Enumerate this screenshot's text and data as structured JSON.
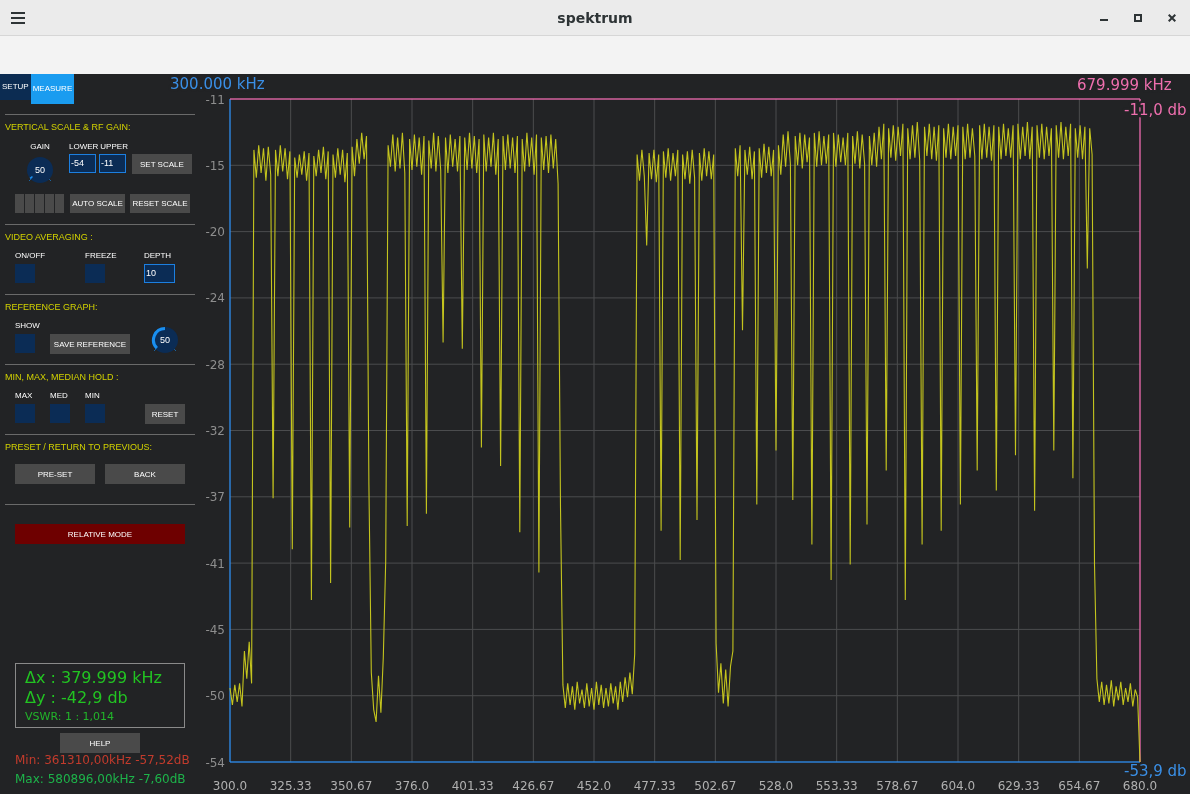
{
  "window": {
    "title": "spektrum"
  },
  "tabs": [
    {
      "label": "SETUP",
      "selected": false
    },
    {
      "label": "MEASURE",
      "selected": true
    }
  ],
  "vertical_scale": {
    "heading": "VERTICAL SCALE & RF GAIN:",
    "gain": {
      "label": "GAIN",
      "value": "50",
      "level": 0.03
    },
    "lower": {
      "label": "LOWER",
      "value": "-54"
    },
    "upper": {
      "label": "UPPER",
      "value": "-11"
    },
    "set_button": "SET SCALE",
    "step_buttons": [
      {
        "selected": false
      },
      {
        "selected": false
      },
      {
        "selected": false
      },
      {
        "selected": false
      },
      {
        "selected": false
      }
    ],
    "auto_button": "AUTO SCALE",
    "reset_button": "RESET SCALE"
  },
  "video_averaging": {
    "heading": "VIDEO AVERAGING :",
    "toggles": [
      {
        "label": "ON/OFF",
        "on": false
      },
      {
        "label": "FREEZE",
        "on": false
      }
    ],
    "depth": {
      "label": "DEPTH",
      "value": "10"
    }
  },
  "reference_graph": {
    "heading": "REFERENCE GRAPH:",
    "show": {
      "label": "SHOW",
      "on": false
    },
    "save_button": "SAVE REFERENCE",
    "knob": {
      "value": "50",
      "level": 0.5
    }
  },
  "hold": {
    "heading": "MIN, MAX, MEDIAN HOLD :",
    "toggles": [
      {
        "label": "MAX",
        "on": false
      },
      {
        "label": "MED",
        "on": false
      },
      {
        "label": "MIN",
        "on": false
      }
    ],
    "reset_button": "RESET"
  },
  "preset": {
    "heading": "PRESET / RETURN TO PREVIOUS:",
    "buttons": [
      "PRE-SET",
      "BACK"
    ]
  },
  "relative_mode_button": "RELATIVE MODE",
  "measurement": {
    "delta_x": "Δx : 379.999 kHz",
    "delta_y": "Δy : -42,9 db",
    "vswr": "VSWR: 1 : 1,014"
  },
  "help_button": "HELP",
  "min_readout": "Min: 361310,00kHz -57,52dB",
  "max_readout": "Max: 580896,00kHz -7,60dB",
  "spectrum": {
    "start_marker": "300.000 kHz",
    "stop_marker": "679.999 kHz",
    "top_level": "-11,0 db",
    "bottom_level": "-53,9 db",
    "chart_data": {
      "type": "line",
      "grid": true,
      "x": [
        300,
        301,
        302,
        303,
        304,
        305,
        306,
        307,
        308,
        309,
        310,
        311,
        312,
        313,
        314,
        315,
        316,
        317,
        318,
        319,
        320,
        321,
        322,
        323,
        324,
        325,
        326,
        327,
        328,
        329,
        330,
        331,
        332,
        333,
        334,
        335,
        336,
        337,
        338,
        339,
        340,
        341,
        342,
        343,
        344,
        345,
        346,
        347,
        348,
        349,
        350,
        351,
        352,
        353,
        354,
        355,
        356,
        357,
        358,
        359,
        360,
        361,
        362,
        363,
        364,
        365,
        366,
        367,
        368,
        369,
        370,
        371,
        372,
        373,
        374,
        375,
        376,
        377,
        378,
        379,
        380,
        381,
        382,
        383,
        384,
        385,
        386,
        387,
        388,
        389,
        390,
        391,
        392,
        393,
        394,
        395,
        396,
        397,
        398,
        399,
        400,
        401,
        402,
        403,
        404,
        405,
        406,
        407,
        408,
        409,
        410,
        411,
        412,
        413,
        414,
        415,
        416,
        417,
        418,
        419,
        420,
        421,
        422,
        423,
        424,
        425,
        426,
        427,
        428,
        429,
        430,
        431,
        432,
        433,
        434,
        435,
        436,
        437,
        438,
        439,
        440,
        441,
        442,
        443,
        444,
        445,
        446,
        447,
        448,
        449,
        450,
        451,
        452,
        453,
        454,
        455,
        456,
        457,
        458,
        459,
        460,
        461,
        462,
        463,
        464,
        465,
        466,
        467,
        468,
        469,
        470,
        471,
        472,
        473,
        474,
        475,
        476,
        477,
        478,
        479,
        480,
        481,
        482,
        483,
        484,
        485,
        486,
        487,
        488,
        489,
        490,
        491,
        492,
        493,
        494,
        495,
        496,
        497,
        498,
        499,
        500,
        501,
        502,
        503,
        504,
        505,
        506,
        507,
        508,
        509,
        510,
        511,
        512,
        513,
        514,
        515,
        516,
        517,
        518,
        519,
        520,
        521,
        522,
        523,
        524,
        525,
        526,
        527,
        528,
        529,
        530,
        531,
        532,
        533,
        534,
        535,
        536,
        537,
        538,
        539,
        540,
        541,
        542,
        543,
        544,
        545,
        546,
        547,
        548,
        549,
        550,
        551,
        552,
        553,
        554,
        555,
        556,
        557,
        558,
        559,
        560,
        561,
        562,
        563,
        564,
        565,
        566,
        567,
        568,
        569,
        570,
        571,
        572,
        573,
        574,
        575,
        576,
        577,
        578,
        579,
        580,
        581,
        582,
        583,
        584,
        585,
        586,
        587,
        588,
        589,
        590,
        591,
        592,
        593,
        594,
        595,
        596,
        597,
        598,
        599,
        600,
        601,
        602,
        603,
        604,
        605,
        606,
        607,
        608,
        609,
        610,
        611,
        612,
        613,
        614,
        615,
        616,
        617,
        618,
        619,
        620,
        621,
        622,
        623,
        624,
        625,
        626,
        627,
        628,
        629,
        630,
        631,
        632,
        633,
        634,
        635,
        636,
        637,
        638,
        639,
        640,
        641,
        642,
        643,
        644,
        645,
        646,
        647,
        648,
        649,
        650,
        651,
        652,
        653,
        654,
        655,
        656,
        657,
        658,
        659,
        660,
        661,
        662,
        663,
        664,
        665,
        666,
        667,
        668,
        669,
        670,
        671,
        672,
        673,
        674,
        675,
        676,
        677,
        678,
        679,
        680
      ],
      "series": [
        {
          "color": "#c4c41e",
          "values": [
            -49.2,
            -50.3,
            -49.0,
            -50.1,
            -48.9,
            -50.4,
            -46.8,
            -48.6,
            -46.2,
            -48.9,
            -14.3,
            -16.1,
            -14.0,
            -15.8,
            -14.2,
            -16.3,
            -14.1,
            -15.9,
            -36.9,
            -14.3,
            -16.0,
            -14.0,
            -15.7,
            -14.2,
            -16.2,
            -14.4,
            -40.2,
            -14.8,
            -16.1,
            -14.6,
            -15.9,
            -14.4,
            -16.3,
            -14.5,
            -43.5,
            -14.7,
            -16.0,
            -14.3,
            -15.8,
            -14.1,
            -16.2,
            -14.4,
            -42.4,
            -14.6,
            -16.1,
            -14.2,
            -15.9,
            -14.3,
            -16.4,
            -14.5,
            -38.8,
            -14.1,
            -16.0,
            -13.6,
            -15.2,
            -13.2,
            -14.9,
            -13.4,
            -36.0,
            -48.2,
            -50.6,
            -51.4,
            -48.4,
            -50.8,
            -47.2,
            -41.0,
            -14.0,
            -15.4,
            -13.3,
            -15.7,
            -13.5,
            -15.5,
            -13.2,
            -15.8,
            -38.7,
            -13.6,
            -15.6,
            -13.3,
            -15.4,
            -13.5,
            -15.9,
            -13.4,
            -37.9,
            -13.7,
            -15.5,
            -13.2,
            -15.7,
            -13.4,
            -15.6,
            -26.8,
            -13.5,
            -15.8,
            -13.3,
            -15.4,
            -13.6,
            -15.7,
            -13.4,
            -27.2,
            -13.5,
            -15.6,
            -13.2,
            -15.5,
            -13.4,
            -15.8,
            -13.6,
            -33.6,
            -13.3,
            -15.7,
            -13.5,
            -15.4,
            -13.2,
            -15.9,
            -13.6,
            -34.8,
            -13.4,
            -15.6,
            -13.3,
            -15.5,
            -13.5,
            -15.8,
            -13.4,
            -39.1,
            -13.6,
            -15.7,
            -13.2,
            -15.4,
            -13.5,
            -15.9,
            -13.3,
            -41.7,
            -13.5,
            -15.6,
            -13.4,
            -15.8,
            -13.3,
            -15.5,
            -13.6,
            -16.5,
            -37.5,
            -49.0,
            -50.5,
            -48.9,
            -50.3,
            -49.1,
            -50.6,
            -48.8,
            -50.2,
            -49.3,
            -50.5,
            -48.9,
            -50.4,
            -49.2,
            -50.6,
            -48.8,
            -50.3,
            -49.0,
            -50.5,
            -49.2,
            -50.4,
            -48.9,
            -50.2,
            -49.1,
            -50.6,
            -48.8,
            -50.1,
            -48.5,
            -49.8,
            -48.2,
            -49.6,
            -47.0,
            -14.6,
            -16.3,
            -14.3,
            -16.0,
            -20.5,
            -14.5,
            -16.2,
            -14.3,
            -16.4,
            -14.6,
            -39.0,
            -14.4,
            -16.1,
            -14.2,
            -16.3,
            -14.5,
            -16.0,
            -14.3,
            -40.9,
            -14.6,
            -16.2,
            -14.4,
            -16.5,
            -14.3,
            -16.1,
            -38.3,
            -14.5,
            -16.3,
            -14.2,
            -16.0,
            -14.4,
            -16.2,
            -14.6,
            -46.3,
            -49.5,
            -47.6,
            -50.2,
            -48.0,
            -50.4,
            -47.8,
            -46.8,
            -14.2,
            -16.0,
            -14.0,
            -26.0,
            -14.3,
            -15.9,
            -14.1,
            -16.2,
            -14.4,
            -37.3,
            -14.2,
            -16.1,
            -13.9,
            -15.8,
            -14.1,
            -16.0,
            -14.3,
            -33.8,
            -14.0,
            -15.9,
            -13.3,
            -15.4,
            -13.1,
            -15.2,
            -37.0,
            -13.4,
            -15.3,
            -13.2,
            -15.5,
            -13.3,
            -15.1,
            -13.5,
            -39.9,
            -13.2,
            -15.4,
            -13.1,
            -15.3,
            -13.4,
            -15.2,
            -13.3,
            -42.2,
            -13.2,
            -15.4,
            -13.3,
            -15.1,
            -13.5,
            -15.3,
            -13.2,
            -41.2,
            -13.4,
            -15.2,
            -13.1,
            -15.5,
            -13.3,
            -15.2,
            -38.6,
            -13.4,
            -15.3,
            -13.2,
            -15.4,
            -12.8,
            -14.9,
            -12.6,
            -35.1,
            -12.9,
            -14.8,
            -12.7,
            -15.0,
            -12.8,
            -14.7,
            -12.6,
            -43.5,
            -12.9,
            -14.9,
            -12.7,
            -14.8,
            -12.5,
            -15.0,
            -39.9,
            -12.8,
            -14.7,
            -12.6,
            -14.9,
            -12.8,
            -15.0,
            -12.7,
            -39.0,
            -12.9,
            -14.8,
            -12.6,
            -14.9,
            -12.8,
            -14.7,
            -12.7,
            -37.3,
            -12.8,
            -14.9,
            -12.6,
            -14.8,
            -12.9,
            -14.7,
            -35.1,
            -12.7,
            -14.9,
            -12.6,
            -14.8,
            -12.8,
            -15.0,
            -12.7,
            -36.4,
            -12.8,
            -14.9,
            -12.6,
            -14.7,
            -12.9,
            -14.8,
            -12.7,
            -34.1,
            -12.6,
            -14.9,
            -12.8,
            -14.7,
            -12.5,
            -14.9,
            -12.8,
            -37.7,
            -12.7,
            -14.8,
            -12.6,
            -14.9,
            -12.8,
            -14.7,
            -12.9,
            -33.8,
            -12.7,
            -14.8,
            -12.5,
            -14.9,
            -12.8,
            -14.7,
            -12.6,
            -35.6,
            -12.9,
            -14.8,
            -12.7,
            -14.9,
            -12.8,
            -22.0,
            -12.9,
            -14.6,
            -41.2,
            -48.6,
            -50.1,
            -48.8,
            -50.3,
            -49.0,
            -50.2,
            -48.7,
            -50.4,
            -49.1,
            -50.0,
            -48.8,
            -50.3,
            -49.2,
            -50.1,
            -48.9,
            -50.4,
            -49.3,
            -49.8,
            -54.0
          ]
        }
      ],
      "xlim": [
        300,
        680
      ],
      "ylim": [
        -54,
        -11
      ],
      "xticks": [
        {
          "value": 300,
          "label": "300.0"
        },
        {
          "value": 325.33,
          "label": "325.33"
        },
        {
          "value": 350.67,
          "label": "350.67"
        },
        {
          "value": 376,
          "label": "376.0"
        },
        {
          "value": 401.33,
          "label": "401.33"
        },
        {
          "value": 426.67,
          "label": "426.67"
        },
        {
          "value": 452,
          "label": "452.0"
        },
        {
          "value": 477.33,
          "label": "477.33"
        },
        {
          "value": 502.67,
          "label": "502.67"
        },
        {
          "value": 528,
          "label": "528.0"
        },
        {
          "value": 553.33,
          "label": "553.33"
        },
        {
          "value": 578.67,
          "label": "578.67"
        },
        {
          "value": 604,
          "label": "604.0"
        },
        {
          "value": 629.33,
          "label": "629.33"
        },
        {
          "value": 654.67,
          "label": "654.67"
        },
        {
          "value": 680,
          "label": "680.0"
        }
      ],
      "yticks": [
        {
          "value": -11,
          "label": "-11"
        },
        {
          "value": -15.3,
          "label": "-15"
        },
        {
          "value": -19.6,
          "label": "-20"
        },
        {
          "value": -23.9,
          "label": "-24"
        },
        {
          "value": -28.2,
          "label": "-28"
        },
        {
          "value": -32.5,
          "label": "-32"
        },
        {
          "value": -36.8,
          "label": "-37"
        },
        {
          "value": -41.1,
          "label": "-41"
        },
        {
          "value": -45.4,
          "label": "-45"
        },
        {
          "value": -49.7,
          "label": "-50"
        },
        {
          "value": -54,
          "label": "-54"
        }
      ]
    }
  }
}
